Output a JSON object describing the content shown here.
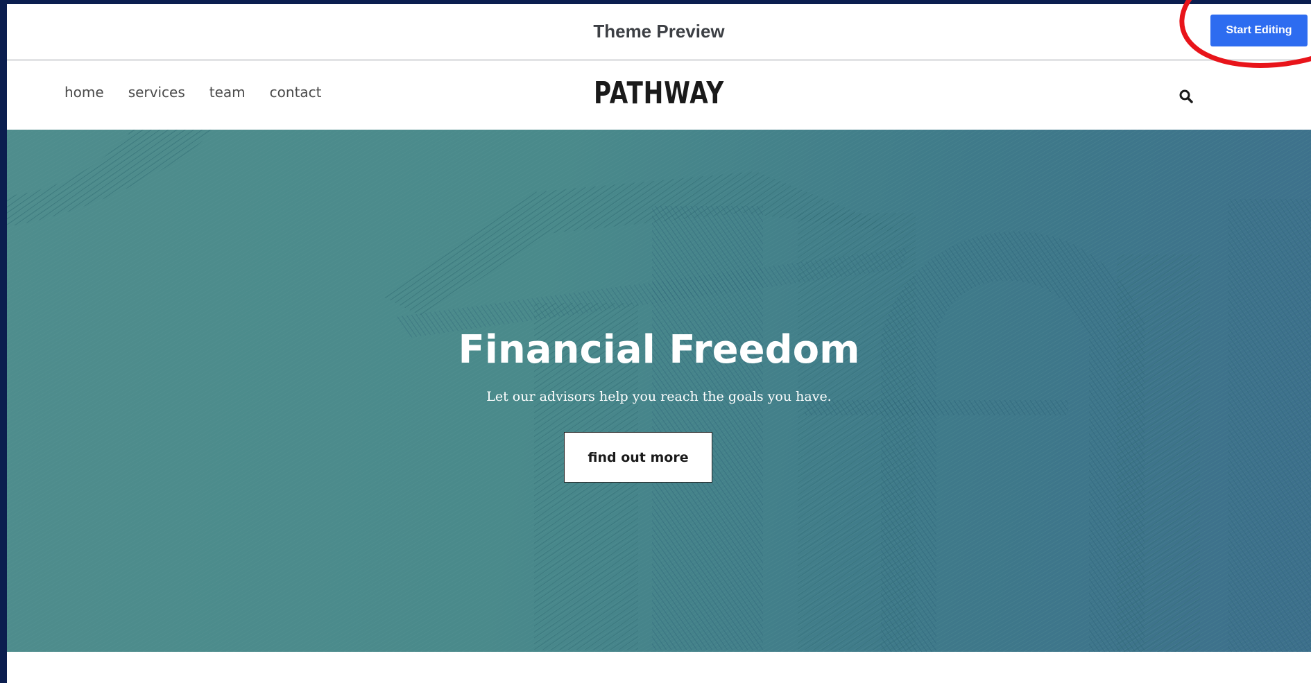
{
  "preview_bar": {
    "title": "Theme Preview",
    "start_editing_label": "Start Editing",
    "accent_color": "#2d6cf0",
    "annotation_color": "#e8141a"
  },
  "site": {
    "nav": [
      {
        "label": "home"
      },
      {
        "label": "services"
      },
      {
        "label": "team"
      },
      {
        "label": "contact"
      }
    ],
    "logo": "PATHWAY",
    "search_icon": "search-icon"
  },
  "hero": {
    "title": "Financial Freedom",
    "subtitle": "Let our advisors help you reach the goals you have.",
    "cta_label": "find out more",
    "background_color": "#4a8a8b"
  }
}
